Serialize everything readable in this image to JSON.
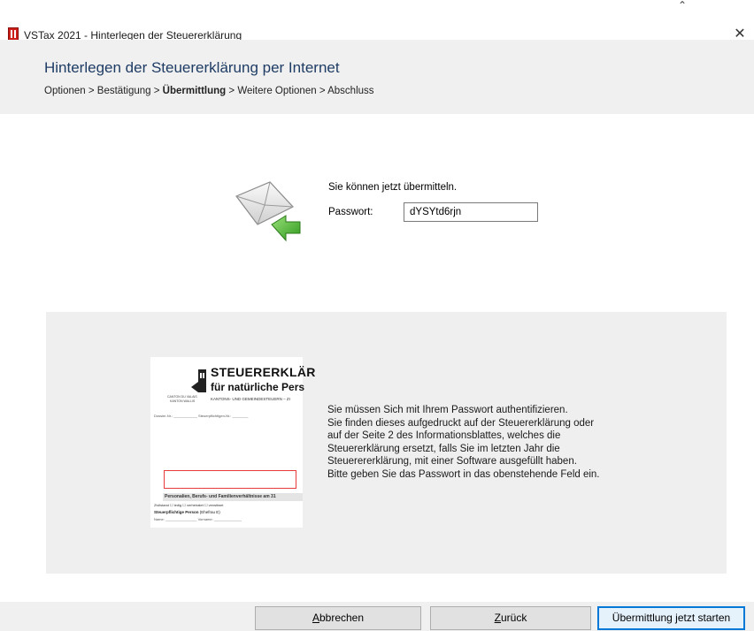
{
  "window": {
    "title": "VSTax 2021 - Hinterlegen der Steuererklärung",
    "close_glyph": "✕",
    "cursor_glyph": "⌃"
  },
  "header": {
    "heading": "Hinterlegen der Steuererklärung per Internet",
    "breadcrumb": {
      "step1": "Optionen",
      "sep": " > ",
      "step2": "Bestätigung",
      "current": "Übermittlung",
      "step4": "Weitere Optionen",
      "step5": "Abschluss"
    }
  },
  "submission": {
    "icon": "envelope-send-icon",
    "status_text": "Sie können jetzt übermitteln.",
    "password_label": "Passwort:",
    "password_value": "dYSYtd6rjn"
  },
  "document_preview": {
    "title": "STEUERERKLÄR",
    "subtitle": "für natürliche Pers",
    "canton_fr": "CANTON DU VALAIS",
    "canton_de": "KANTON WALLIS",
    "kantons_line": "KANTONS- UND GEMEINDESTEUERN  –  ZI",
    "dossier_line": "Dossier-Nr.: ____________  Steuerpflichtigen-Nr.: ________",
    "section_bar": "Personalien, Berufs- und Familienverhältnisse am 31",
    "row1": "Zivilstand     ☐ ledig        ☐ verheiratet        ☐ verwitwet",
    "row2": "Steuerpflichtige Person",
    "row2_suffix": "(Ehefrau E)",
    "row3": "Name: ________________   Vorname: ______________"
  },
  "info": {
    "lines": [
      "Sie müssen Sich mit Ihrem Passwort authentifizieren.",
      "Sie finden dieses aufgedruckt auf der Steuererklärung oder",
      "auf der Seite 2 des Informationsblattes, welches die",
      "Steuererklärung ersetzt, falls Sie im letzten Jahr die",
      "Steuerererklärung, mit einer Software ausgefüllt haben.",
      "Bitte geben Sie das Passwort in das obenstehende Feld ein."
    ]
  },
  "footer": {
    "cancel": {
      "mnemonic": "A",
      "rest": "bbrechen"
    },
    "back": {
      "mnemonic": "Z",
      "rest": "urück"
    },
    "submit_label": "Übermittlung jetzt starten"
  },
  "colors": {
    "heading": "#1e3c64",
    "accent_button_border": "#0078d7",
    "app_icon": "#cc1f1a",
    "panel_bg": "#efefef",
    "header_bg": "#f0f0f0"
  }
}
